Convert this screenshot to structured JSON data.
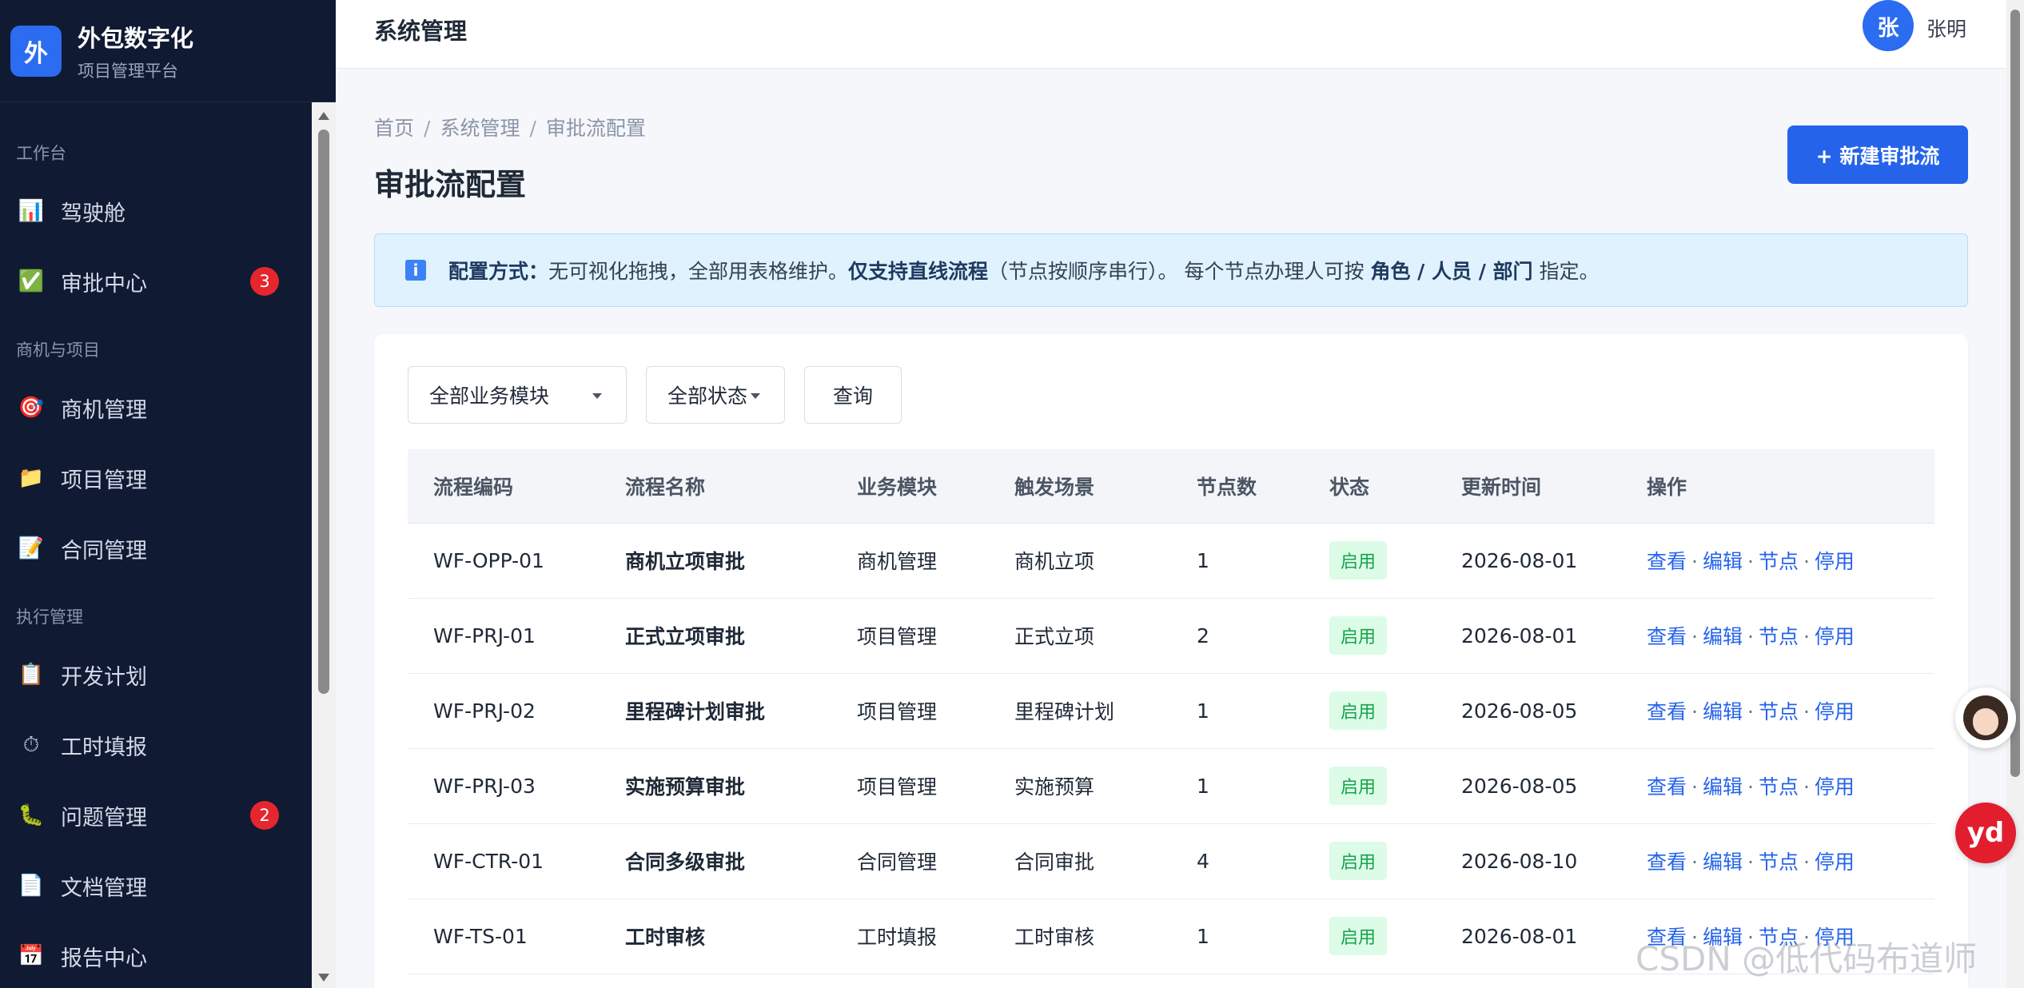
{
  "brand": {
    "logo": "外",
    "title": "外包数字化",
    "subtitle": "项目管理平台"
  },
  "sidebar": {
    "sections": [
      {
        "title": "工作台",
        "items": [
          {
            "label": "驾驶舱",
            "icon": "chart-icon",
            "glyph": "📊"
          },
          {
            "label": "审批中心",
            "icon": "check-icon",
            "glyph": "✅",
            "badge": "3"
          }
        ]
      },
      {
        "title": "商机与项目",
        "items": [
          {
            "label": "商机管理",
            "icon": "target-icon",
            "glyph": "🎯"
          },
          {
            "label": "项目管理",
            "icon": "folder-icon",
            "glyph": "📁"
          },
          {
            "label": "合同管理",
            "icon": "memo-icon",
            "glyph": "📝"
          }
        ]
      },
      {
        "title": "执行管理",
        "items": [
          {
            "label": "开发计划",
            "icon": "clipboard-icon",
            "glyph": "📋"
          },
          {
            "label": "工时填报",
            "icon": "stopwatch-icon",
            "glyph": "⏱"
          },
          {
            "label": "问题管理",
            "icon": "bug-icon",
            "glyph": "🐛",
            "badge": "2"
          },
          {
            "label": "文档管理",
            "icon": "document-icon",
            "glyph": "📄"
          },
          {
            "label": "报告中心",
            "icon": "calendar-icon",
            "glyph": "📅"
          }
        ]
      }
    ]
  },
  "header": {
    "title": "系统管理",
    "avatar": "张",
    "username": "张明"
  },
  "breadcrumb": [
    "首页",
    "系统管理",
    "审批流配置"
  ],
  "breadcrumb_sep": "/",
  "page": {
    "title": "审批流配置",
    "new_button": "+ 新建审批流"
  },
  "info": {
    "icon": "i",
    "label": "配置方式：",
    "text1": "无可视化拖拽，全部用表格维护。",
    "bold1": "仅支持直线流程",
    "text2": "（节点按顺序串行）。 每个节点办理人可按 ",
    "bold2": "角色 / 人员 / 部门",
    "text3": " 指定。"
  },
  "filters": {
    "module": "全部业务模块",
    "status": "全部状态",
    "query": "查询"
  },
  "table": {
    "columns": [
      "流程编码",
      "流程名称",
      "业务模块",
      "触发场景",
      "节点数",
      "状态",
      "更新时间",
      "操作"
    ],
    "rows": [
      {
        "code": "WF-OPP-01",
        "name": "商机立项审批",
        "module": "商机管理",
        "scene": "商机立项",
        "nodes": "1",
        "status": "启用",
        "updated": "2026-08-01"
      },
      {
        "code": "WF-PRJ-01",
        "name": "正式立项审批",
        "module": "项目管理",
        "scene": "正式立项",
        "nodes": "2",
        "status": "启用",
        "updated": "2026-08-01"
      },
      {
        "code": "WF-PRJ-02",
        "name": "里程碑计划审批",
        "module": "项目管理",
        "scene": "里程碑计划",
        "nodes": "1",
        "status": "启用",
        "updated": "2026-08-05"
      },
      {
        "code": "WF-PRJ-03",
        "name": "实施预算审批",
        "module": "项目管理",
        "scene": "实施预算",
        "nodes": "1",
        "status": "启用",
        "updated": "2026-08-05"
      },
      {
        "code": "WF-CTR-01",
        "name": "合同多级审批",
        "module": "合同管理",
        "scene": "合同审批",
        "nodes": "4",
        "status": "启用",
        "updated": "2026-08-10"
      },
      {
        "code": "WF-TS-01",
        "name": "工时审核",
        "module": "工时填报",
        "scene": "工时审核",
        "nodes": "1",
        "status": "启用",
        "updated": "2026-08-01"
      }
    ],
    "actions": [
      "查看",
      "编辑",
      "节点",
      "停用"
    ],
    "action_sep": "·"
  },
  "widgets": {
    "yd": "yd",
    "watermark": "CSDN @低代码布道师"
  },
  "colors": {
    "sidebar_bg": "#101a33",
    "primary": "#2563eb",
    "badge": "#e5262d",
    "status_bg": "#dcfce7",
    "status_text": "#16a34a",
    "info_bg": "#e0f2fe"
  }
}
